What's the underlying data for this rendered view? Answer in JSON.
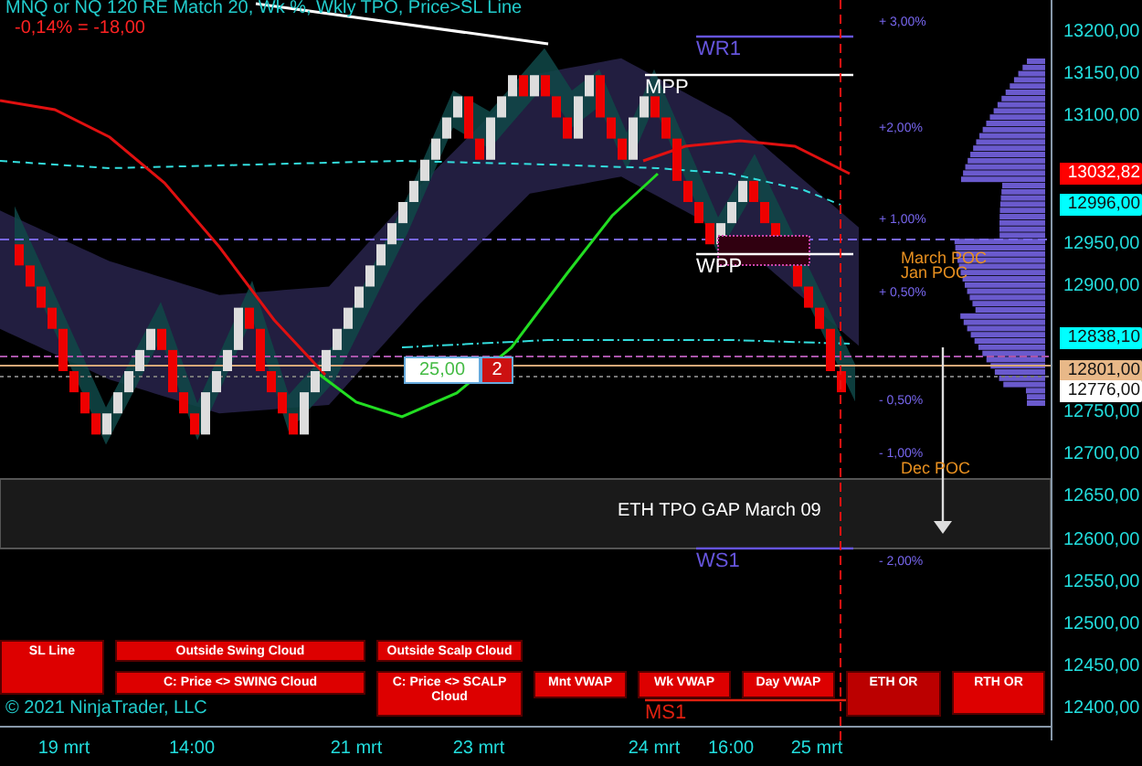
{
  "header": {
    "title": "MNQ or NQ 120 RE Match 20, Wk %, Wkly TPO, Price>SL Line",
    "change": "-0,14% = -18,00"
  },
  "pivot_labels": [
    "WR1",
    "MPP",
    "WPP",
    "WS1",
    "MS1"
  ],
  "percent_labels": [
    "+ 3,00%",
    "+2,00%",
    "+ 1,00%",
    "+ 0,50%",
    "- 0,50%",
    "- 1,00%",
    "- 2,00%"
  ],
  "poc_labels": [
    "March POC",
    "Jan POC",
    "Dec POC"
  ],
  "gap_label": "ETH TPO GAP March 09",
  "order_box": {
    "value": "25,00",
    "count": "2"
  },
  "price_axis": [
    "13200,00",
    "13150,00",
    "13100,00",
    "12950,00",
    "12900,00",
    "12750,00",
    "12700,00",
    "12650,00",
    "12600,00",
    "12550,00",
    "12500,00",
    "12450,00",
    "12400,00"
  ],
  "price_badges": [
    {
      "text": "13032,82",
      "color": "#ff0000"
    },
    {
      "text": "12996,00",
      "color": "#00ffff"
    },
    {
      "text": "12838,10",
      "color": "#00ffff"
    },
    {
      "text": "12801,00",
      "color": "#e8b888"
    },
    {
      "text": "12776,00",
      "color": "#ffffff"
    }
  ],
  "buttons": [
    "SL Line",
    "Outside Swing Cloud",
    "Outside Scalp Cloud",
    "C: Price <> SWING Cloud",
    "C: Price <> SCALP Cloud",
    "Mnt VWAP",
    "Wk VWAP",
    "Day VWAP",
    "ETH OR",
    "RTH OR"
  ],
  "copyright": "© 2021 NinjaTrader, LLC",
  "time_axis": [
    "19 mrt",
    "14:00",
    "21 mrt",
    "23 mrt",
    "24 mrt",
    "16:00",
    "25 mrt"
  ]
}
